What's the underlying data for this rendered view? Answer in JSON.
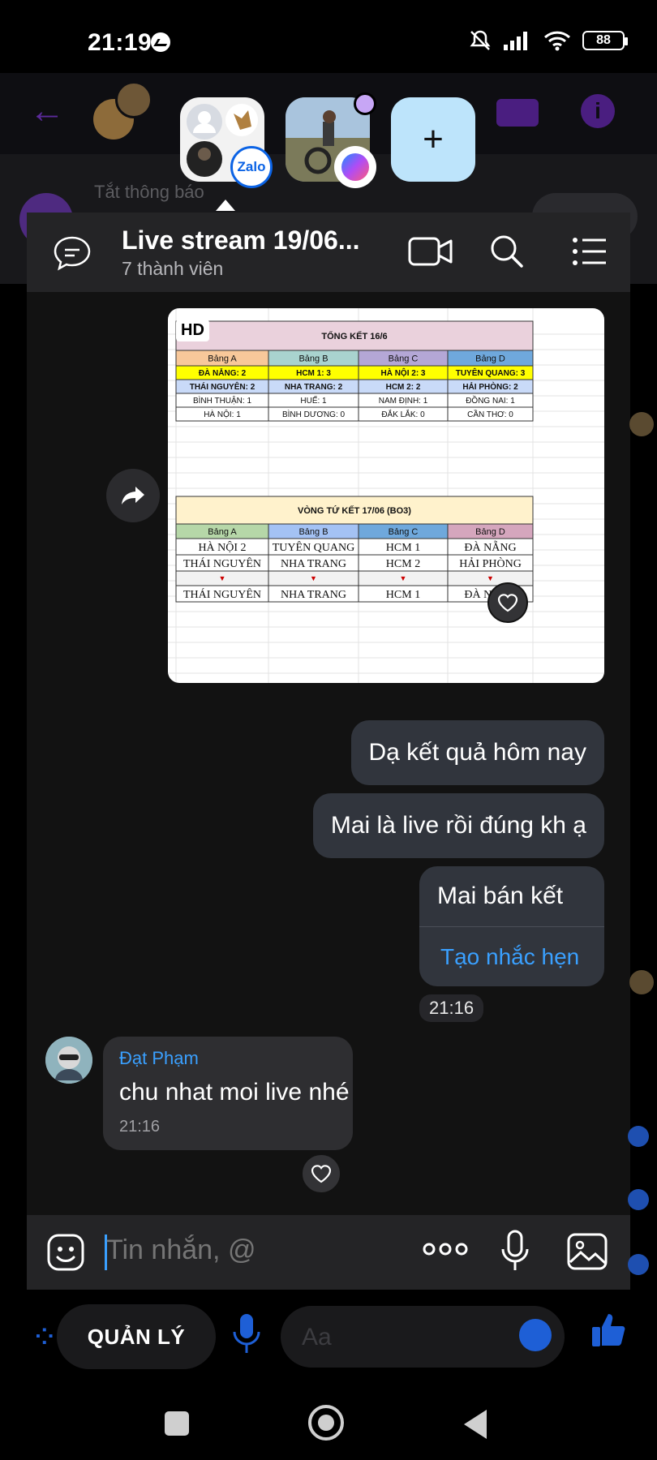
{
  "status_bar": {
    "time": "21:19",
    "battery": "88"
  },
  "background": {
    "notice": "Tắt thông báo",
    "bottom": {
      "manage_label": "QUẢN LÝ",
      "input_placeholder": "Aa"
    }
  },
  "bubbles": {
    "zalo_label": "Zalo",
    "add_label": "+"
  },
  "chat": {
    "title": "Live stream 19/06...",
    "subtitle": "7 thành viên",
    "image_badge": "HD",
    "messages_out": [
      "Dạ kết quả hôm nay",
      "Mai là live rồi đúng kh ạ"
    ],
    "reminder": {
      "text": "Mai bán kết",
      "link": "Tạo nhắc hẹn"
    },
    "sent_time": "21:16",
    "incoming": {
      "sender": "Đạt Phạm",
      "text": "chu nhat moi live nhé",
      "time": "21:16"
    },
    "composer_placeholder": "Tin nhắn, @"
  },
  "sheet": {
    "summary_title": "TỔNG KẾT 16/6",
    "group_headers": [
      "Bảng A",
      "Bảng B",
      "Bảng C",
      "Bảng D"
    ],
    "group_colors": [
      "#f8c89a",
      "#a9d3cf",
      "#b4a7d6",
      "#6fa8dc"
    ],
    "groups": [
      [
        "ĐÀ NẴNG: 2",
        "HCM 1: 3",
        "HÀ NỘI 2: 3",
        "TUYÊN QUANG: 3"
      ],
      [
        "THÁI NGUYÊN: 2",
        "NHA TRANG: 2",
        "HCM 2: 2",
        "HẢI PHÒNG: 2"
      ],
      [
        "BÌNH THUẬN: 1",
        "HUẾ: 1",
        "NAM ĐỊNH: 1",
        "ĐỒNG NAI: 1"
      ],
      [
        "HÀ NỘI: 1",
        "BÌNH DƯƠNG: 0",
        "ĐẮK LẮK: 0",
        "CẦN THƠ: 0"
      ]
    ],
    "qf_title": "VÒNG TỨ KẾT 17/06 (BO3)",
    "qf_headers": [
      "Bảng A",
      "Bảng B",
      "Bảng C",
      "Bảng D"
    ],
    "qf_colors": [
      "#b6d7a8",
      "#a4c2f4",
      "#6fa8dc",
      "#d5a6bd"
    ],
    "qf_rows": [
      [
        "HÀ NỘI 2",
        "TUYÊN QUANG",
        "HCM 1",
        "ĐÀ NẴNG"
      ],
      [
        "THÁI NGUYÊN",
        "NHA TRANG",
        "HCM 2",
        "HẢI PHÒNG"
      ]
    ],
    "qf_arrow": "▼",
    "qf_winners": [
      "THÁI NGUYÊN",
      "NHA TRANG",
      "HCM 1",
      "ĐÀ NẴNG"
    ]
  }
}
